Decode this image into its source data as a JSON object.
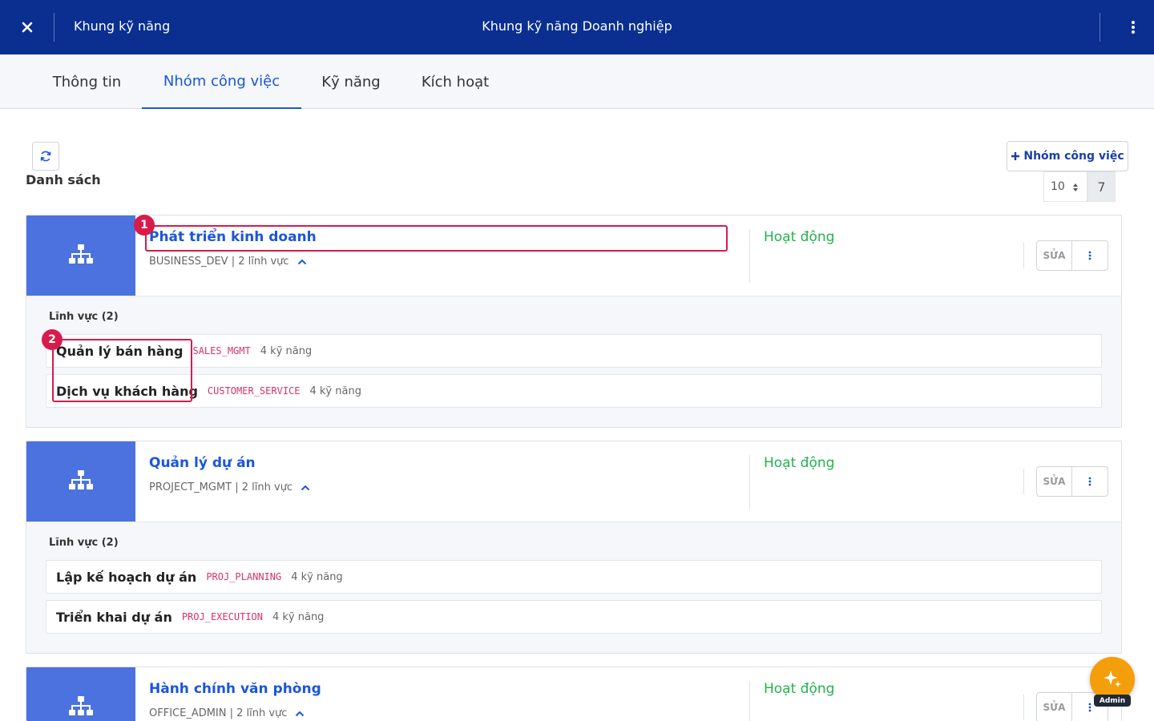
{
  "header": {
    "left_title": "Khung kỹ năng",
    "center_title": "Khung kỹ năng Doanh nghiệp"
  },
  "tabs": [
    {
      "label": "Thông tin",
      "active": false
    },
    {
      "label": "Nhóm công việc",
      "active": true
    },
    {
      "label": "Kỹ năng",
      "active": false
    },
    {
      "label": "Kích hoạt",
      "active": false
    }
  ],
  "toolbar": {
    "list_title": "Danh sách",
    "add_label": "Nhóm công việc",
    "page_size": "10",
    "total": "7"
  },
  "groups": [
    {
      "name": "Phát triển kinh doanh",
      "meta": "BUSINESS_DEV | 2 lĩnh vực",
      "status": "Hoạt động",
      "edit_label": "SỬA",
      "fields_title": "Lĩnh vực (2)",
      "fields": [
        {
          "name": "Quản lý bán hàng",
          "code": "SALES_MGMT",
          "count": "4 kỹ năng"
        },
        {
          "name": "Dịch vụ khách hàng",
          "code": "CUSTOMER_SERVICE",
          "count": "4 kỹ năng"
        }
      ]
    },
    {
      "name": "Quản lý dự án",
      "meta": "PROJECT_MGMT | 2 lĩnh vực",
      "status": "Hoạt động",
      "edit_label": "SỬA",
      "fields_title": "Lĩnh vực (2)",
      "fields": [
        {
          "name": "Lập kế hoạch dự án",
          "code": "PROJ_PLANNING",
          "count": "4 kỹ năng"
        },
        {
          "name": "Triển khai dự án",
          "code": "PROJ_EXECUTION",
          "count": "4 kỹ năng"
        }
      ]
    },
    {
      "name": "Hành chính văn phòng",
      "meta": "OFFICE_ADMIN | 2 lĩnh vực",
      "status": "Hoạt động",
      "edit_label": "SỬA"
    }
  ],
  "annotations": [
    "1",
    "2"
  ],
  "fab": {
    "label": "Admin"
  },
  "colors": {
    "header_bg": "#0a2f91",
    "accent": "#1a56db",
    "status_active": "#22b24c",
    "group_icon_bg": "#4b72de",
    "highlight": "#d81b4a",
    "fab": "#f59e0b"
  }
}
